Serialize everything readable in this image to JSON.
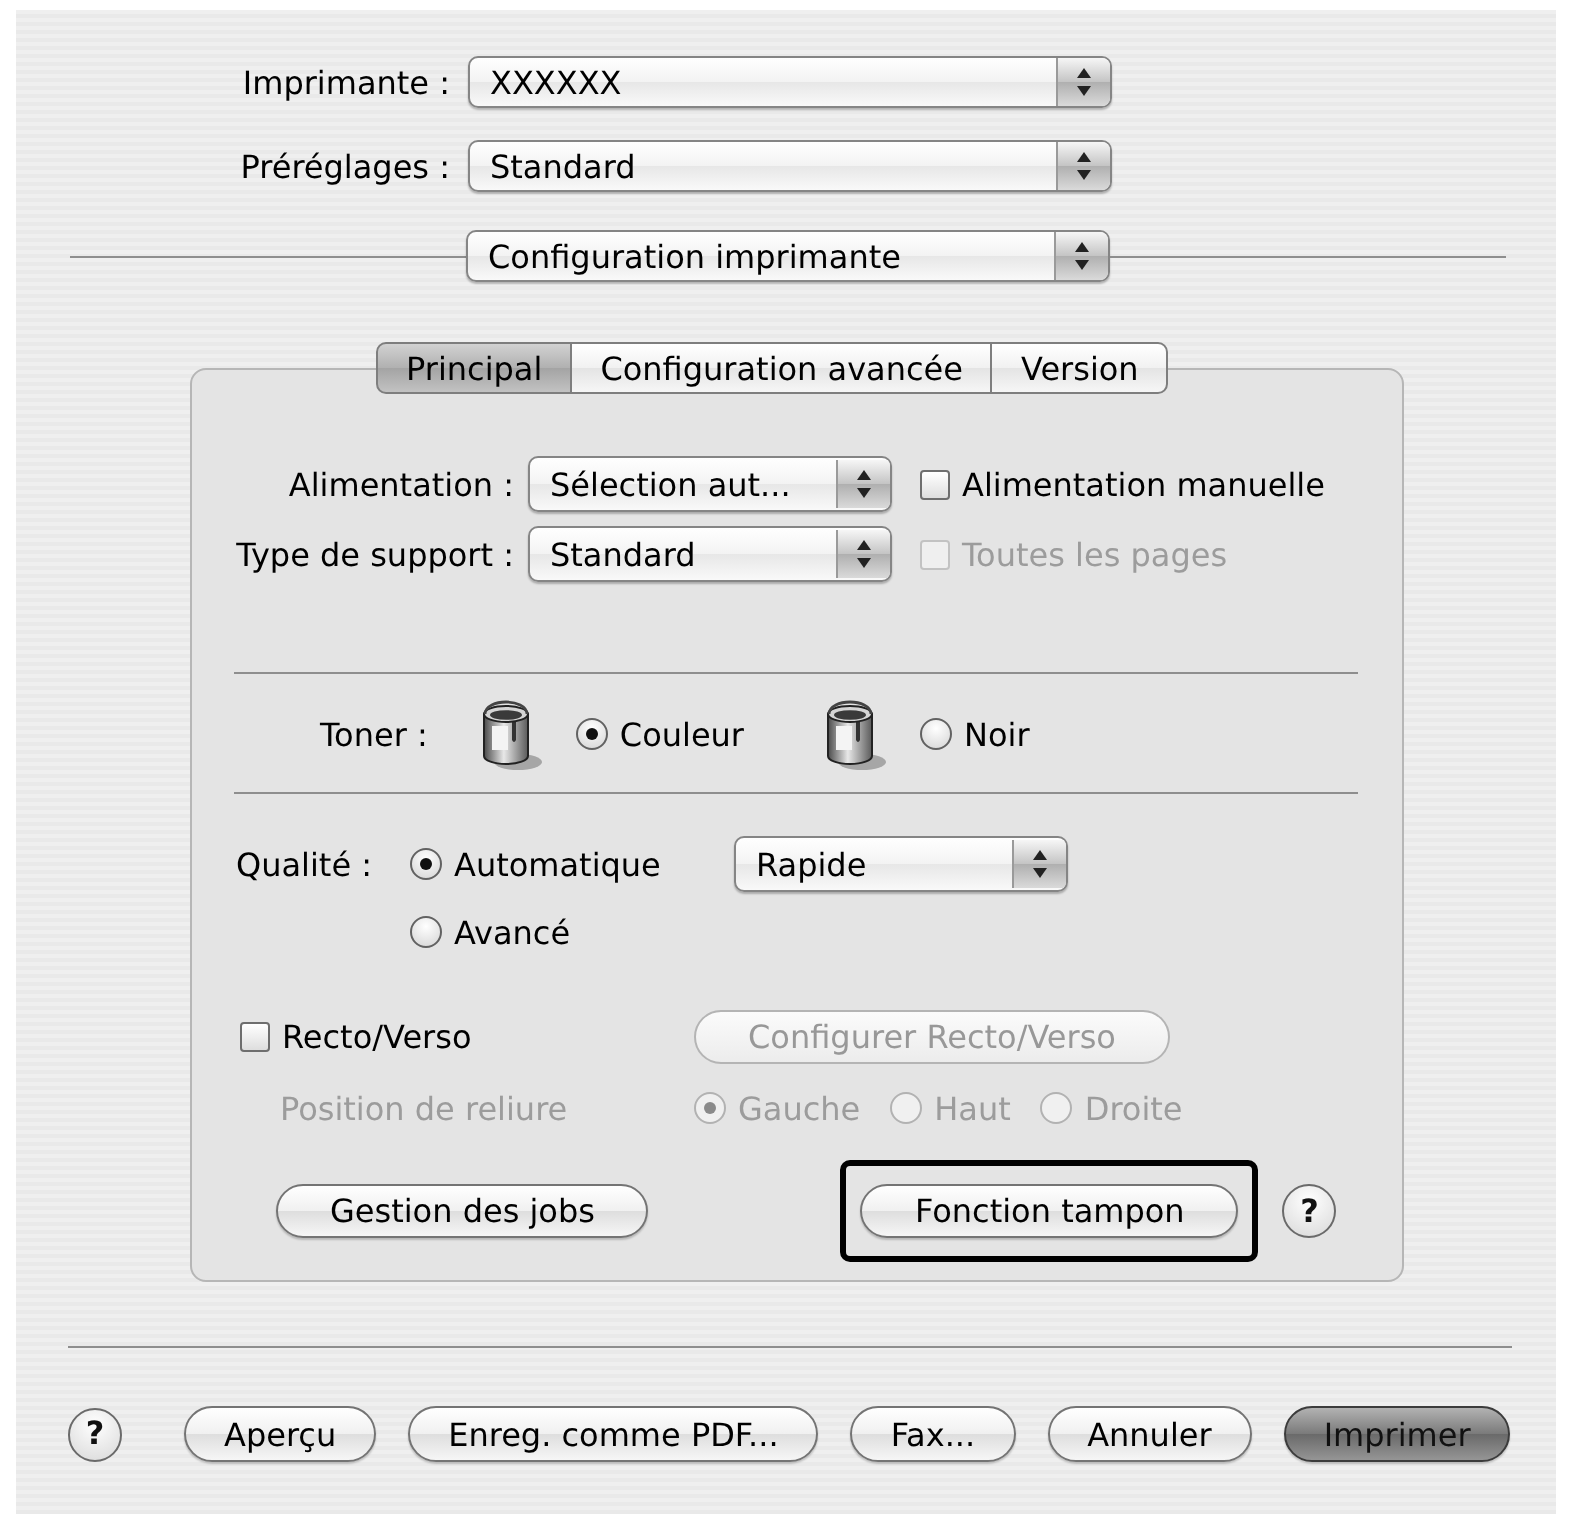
{
  "top_popups": [
    {
      "label": "Imprimante :",
      "value": "XXXXXX"
    },
    {
      "label": "Préréglages :",
      "value": "Standard"
    }
  ],
  "section_popup": {
    "value": "Configuration imprimante"
  },
  "tabs": [
    {
      "label": "Principal",
      "selected": true
    },
    {
      "label": "Configuration avancée",
      "selected": false
    },
    {
      "label": "Version",
      "selected": false
    }
  ],
  "panel": {
    "paper_rows": [
      {
        "label": "Alimentation :",
        "value": "Sélection aut...",
        "checkbox": {
          "label": "Alimentation manuelle",
          "checked": false,
          "disabled": false
        }
      },
      {
        "label": "Type de support :",
        "value": "Standard",
        "checkbox": {
          "label": "Toutes les pages",
          "checked": false,
          "disabled": true
        }
      }
    ],
    "toner": {
      "label": "Toner :",
      "options": [
        {
          "label": "Couleur",
          "selected": true
        },
        {
          "label": "Noir",
          "selected": false
        }
      ]
    },
    "quality": {
      "label": "Qualité :",
      "options": [
        {
          "label": "Automatique",
          "selected": true
        },
        {
          "label": "Avancé",
          "selected": false
        }
      ],
      "preset_value": "Rapide"
    },
    "duplex": {
      "label": "Recto/Verso",
      "checked": false,
      "button": {
        "label": "Configurer Recto/Verso",
        "disabled": true
      },
      "binding": {
        "label": "Position de reliure",
        "disabled": true,
        "options": [
          {
            "label": "Gauche",
            "selected": true
          },
          {
            "label": "Haut",
            "selected": false
          },
          {
            "label": "Droite",
            "selected": false
          }
        ]
      }
    },
    "buttons": [
      {
        "label": "Gestion des jobs",
        "highlighted": false
      },
      {
        "label": "Fonction tampon",
        "highlighted": true
      }
    ],
    "help": "?"
  },
  "footer": {
    "help": "?",
    "buttons": [
      {
        "label": "Aperçu",
        "default": false
      },
      {
        "label": "Enreg. comme PDF...",
        "default": false
      },
      {
        "label": "Fax...",
        "default": false
      },
      {
        "label": "Annuler",
        "default": false
      },
      {
        "label": "Imprimer",
        "default": true
      }
    ]
  }
}
